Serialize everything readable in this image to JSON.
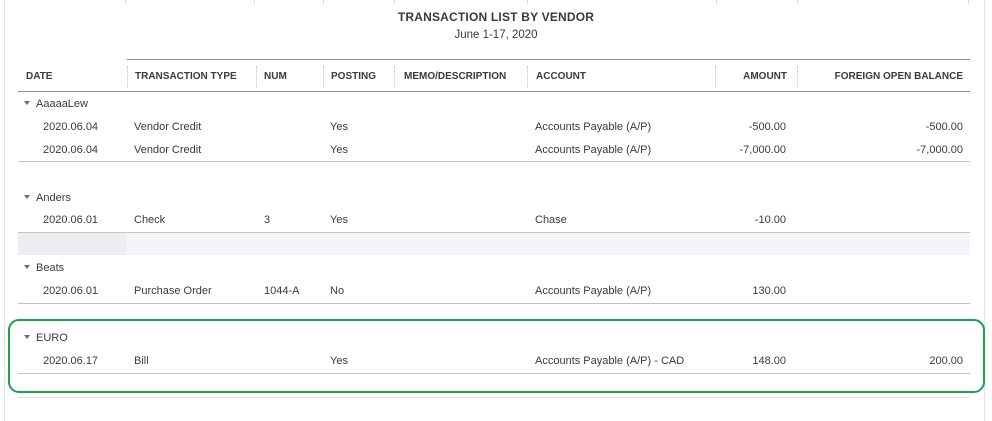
{
  "report": {
    "title": "TRANSACTION LIST BY VENDOR",
    "subtitle": "June 1-17, 2020"
  },
  "columns": {
    "date": "DATE",
    "transaction_type": "TRANSACTION TYPE",
    "num": "NUM",
    "posting": "POSTING",
    "memo": "MEMO/DESCRIPTION",
    "account": "ACCOUNT",
    "amount": "AMOUNT",
    "foreign_open_balance": "FOREIGN OPEN BALANCE"
  },
  "groups": [
    {
      "vendor": "AaaaaLew",
      "rows": [
        {
          "date": "2020.06.04",
          "type": "Vendor Credit",
          "num": "",
          "posting": "Yes",
          "memo": "",
          "account": "Accounts Payable (A/P)",
          "amount": "-500.00",
          "foreign": "-500.00"
        },
        {
          "date": "2020.06.04",
          "type": "Vendor Credit",
          "num": "",
          "posting": "Yes",
          "memo": "",
          "account": "Accounts Payable (A/P)",
          "amount": "-7,000.00",
          "foreign": "-7,000.00"
        }
      ]
    },
    {
      "vendor": "Anders",
      "rows": [
        {
          "date": "2020.06.01",
          "type": "Check",
          "num": "3",
          "posting": "Yes",
          "memo": "",
          "account": "Chase",
          "amount": "-10.00",
          "foreign": ""
        }
      ]
    },
    {
      "vendor": "Beats",
      "rows": [
        {
          "date": "2020.06.01",
          "type": "Purchase Order",
          "num": "1044-A",
          "posting": "No",
          "memo": "",
          "account": "Accounts Payable (A/P)",
          "amount": "130.00",
          "foreign": ""
        }
      ]
    },
    {
      "vendor": "EURO",
      "rows": [
        {
          "date": "2020.06.17",
          "type": "Bill",
          "num": "",
          "posting": "Yes",
          "memo": "",
          "account": "Accounts Payable (A/P) - CAD",
          "amount": "148.00",
          "foreign": "200.00"
        }
      ]
    }
  ],
  "colors": {
    "highlight_border": "#1aa34a",
    "text": "#393a3d",
    "band": "#eceef1"
  }
}
